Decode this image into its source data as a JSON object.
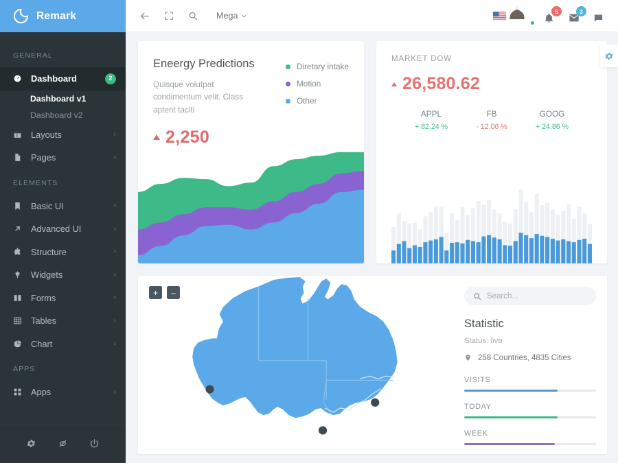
{
  "brand": {
    "name": "Remark",
    "logo_icon": "crescent-logo-icon",
    "bg": "#5ba9e8"
  },
  "sidebar": {
    "sections": [
      {
        "label": "GENERAL",
        "items": [
          {
            "label": "Dashboard",
            "icon": "dashboard-icon",
            "badge": "2",
            "active": true,
            "arrow": ""
          },
          {
            "label": "Layouts",
            "icon": "layouts-icon",
            "badge": "",
            "active": false,
            "arrow": "›"
          },
          {
            "label": "Pages",
            "icon": "pages-icon",
            "badge": "",
            "active": false,
            "arrow": "›"
          }
        ],
        "subitems": [
          {
            "label": "Dashboard v1",
            "active": true
          },
          {
            "label": "Dashboard v2",
            "active": false
          }
        ]
      },
      {
        "label": "ELEMENTS",
        "items": [
          {
            "label": "Basic UI",
            "icon": "bookmark-icon",
            "badge": "",
            "active": false,
            "arrow": "›"
          },
          {
            "label": "Advanced UI",
            "icon": "arrow-up-right-icon",
            "badge": "",
            "active": false,
            "arrow": "›"
          },
          {
            "label": "Structure",
            "icon": "puzzle-icon",
            "badge": "",
            "active": false,
            "arrow": "›"
          },
          {
            "label": "Widgets",
            "icon": "widgets-icon",
            "badge": "",
            "active": false,
            "arrow": "›"
          },
          {
            "label": "Forms",
            "icon": "forms-icon",
            "badge": "",
            "active": false,
            "arrow": "›"
          },
          {
            "label": "Tables",
            "icon": "table-icon",
            "badge": "",
            "active": false,
            "arrow": "›"
          },
          {
            "label": "Chart",
            "icon": "pie-chart-icon",
            "badge": "",
            "active": false,
            "arrow": "›"
          }
        ],
        "subitems": []
      },
      {
        "label": "APPS",
        "items": [
          {
            "label": "Apps",
            "icon": "grid-apps-icon",
            "badge": "",
            "active": false,
            "arrow": "›"
          }
        ],
        "subitems": []
      }
    ],
    "footer_icons": [
      "gear-icon",
      "eye-slash-icon",
      "power-icon"
    ]
  },
  "topbar": {
    "back_icon": "back-arrow-icon",
    "fullscreen_icon": "fullscreen-icon",
    "search_icon": "search-icon",
    "mega_label": "Mega",
    "mega_caret": "⌄",
    "flag_icon": "us-flag-icon",
    "avatar_icon": "avatar",
    "notifications": {
      "icon": "bell-icon",
      "count": "5",
      "color": "#ef6b6b"
    },
    "messages": {
      "icon": "envelope-icon",
      "count": "3",
      "color": "#4db8d8"
    },
    "chat": {
      "icon": "chat-icon",
      "count": "",
      "color": ""
    }
  },
  "energy_card": {
    "title": "Eneergy Predictions",
    "description": "Quisque volutpat condimentum velit. Class aptent taciti",
    "value": "2,250",
    "trend_icon": "triangle-up-icon",
    "trend_color": "#df6b6b",
    "legend": [
      {
        "label": "Diretary intake",
        "color": "#3dba87"
      },
      {
        "label": "Motion",
        "color": "#8a63d2"
      },
      {
        "label": "Other",
        "color": "#5ba9e8"
      }
    ]
  },
  "market_card": {
    "title": "MARKET DOW",
    "value": "26,580.62",
    "trend_icon": "triangle-up-icon",
    "stocks": [
      {
        "symbol": "APPL",
        "change": "+ 82.24 %",
        "color": "#3dba87"
      },
      {
        "symbol": "FB",
        "change": "- 12.06 %",
        "color": "#e8726f"
      },
      {
        "symbol": "GOOG",
        "change": "+ 24.86 %",
        "color": "#3dba87"
      }
    ]
  },
  "map_card": {
    "zoom_in_label": "+",
    "zoom_out_label": "–",
    "region": "Australia",
    "markers": 3
  },
  "statistic": {
    "search_placeholder": "Search...",
    "search_value": "",
    "search_icon": "search-icon",
    "title": "Statistic",
    "status": "Status: live",
    "location_icon": "map-pin-icon",
    "location": "258 Countries, 4835 Cities",
    "progress": [
      {
        "label": "VISITS",
        "percent": 71,
        "color": "#5b96c8"
      },
      {
        "label": "TODAY",
        "percent": 71,
        "color": "#3dba87"
      },
      {
        "label": "WEEK",
        "percent": 69,
        "color": "#8a72b5"
      }
    ]
  },
  "settings_tab": {
    "icon": "gear-icon",
    "color": "#5ba9e8"
  },
  "chart_data": [
    {
      "type": "area",
      "title": "Eneergy Predictions",
      "stacked": true,
      "x": [
        0,
        1,
        2,
        3,
        4,
        5,
        6,
        7,
        8,
        9,
        10
      ],
      "series": [
        {
          "name": "Other",
          "color": "#5ba9e8",
          "values": [
            18,
            26,
            35,
            43,
            44,
            40,
            46,
            54,
            62,
            72,
            74
          ]
        },
        {
          "name": "Motion",
          "color": "#8a63d2",
          "values": [
            22,
            20,
            18,
            16,
            15,
            17,
            18,
            18,
            17,
            16,
            16
          ]
        },
        {
          "name": "Diretary intake",
          "color": "#3dba87",
          "values": [
            32,
            33,
            31,
            24,
            18,
            23,
            30,
            28,
            24,
            18,
            16
          ]
        }
      ],
      "ylim": [
        0,
        110
      ],
      "grid": false,
      "legend": "top-right",
      "xlabel": "",
      "ylabel": ""
    },
    {
      "type": "bar",
      "title": "MARKET DOW",
      "stacked": true,
      "categories": [
        "1",
        "2",
        "3",
        "4",
        "5",
        "6",
        "7",
        "8",
        "9",
        "10",
        "11",
        "12",
        "13",
        "14",
        "15",
        "16",
        "17",
        "18",
        "19",
        "20",
        "21",
        "22",
        "23",
        "24",
        "25",
        "26",
        "27",
        "28",
        "29",
        "30",
        "31",
        "32",
        "33",
        "34",
        "35",
        "36",
        "37",
        "38",
        "39",
        "40"
      ],
      "series": [
        {
          "name": "Volume",
          "color": "#4a9ada",
          "values": [
            22,
            33,
            38,
            26,
            31,
            28,
            36,
            39,
            41,
            45,
            22,
            35,
            36,
            34,
            40,
            38,
            36,
            46,
            48,
            44,
            41,
            31,
            30,
            38,
            52,
            48,
            43,
            50,
            47,
            45,
            42,
            39,
            41,
            38,
            36,
            40,
            42,
            33,
            0,
            0
          ]
        },
        {
          "name": "Range",
          "color": "#eef1f3",
          "values": [
            40,
            52,
            34,
            42,
            38,
            30,
            44,
            48,
            56,
            52,
            30,
            50,
            38,
            62,
            42,
            56,
            70,
            54,
            60,
            48,
            44,
            40,
            38,
            54,
            74,
            56,
            44,
            68,
            52,
            58,
            50,
            44,
            48,
            62,
            40,
            56,
            44,
            34,
            0,
            0
          ]
        }
      ],
      "ylim": [
        0,
        140
      ],
      "grid": false,
      "legend": "none",
      "xlabel": "",
      "ylabel": ""
    }
  ]
}
